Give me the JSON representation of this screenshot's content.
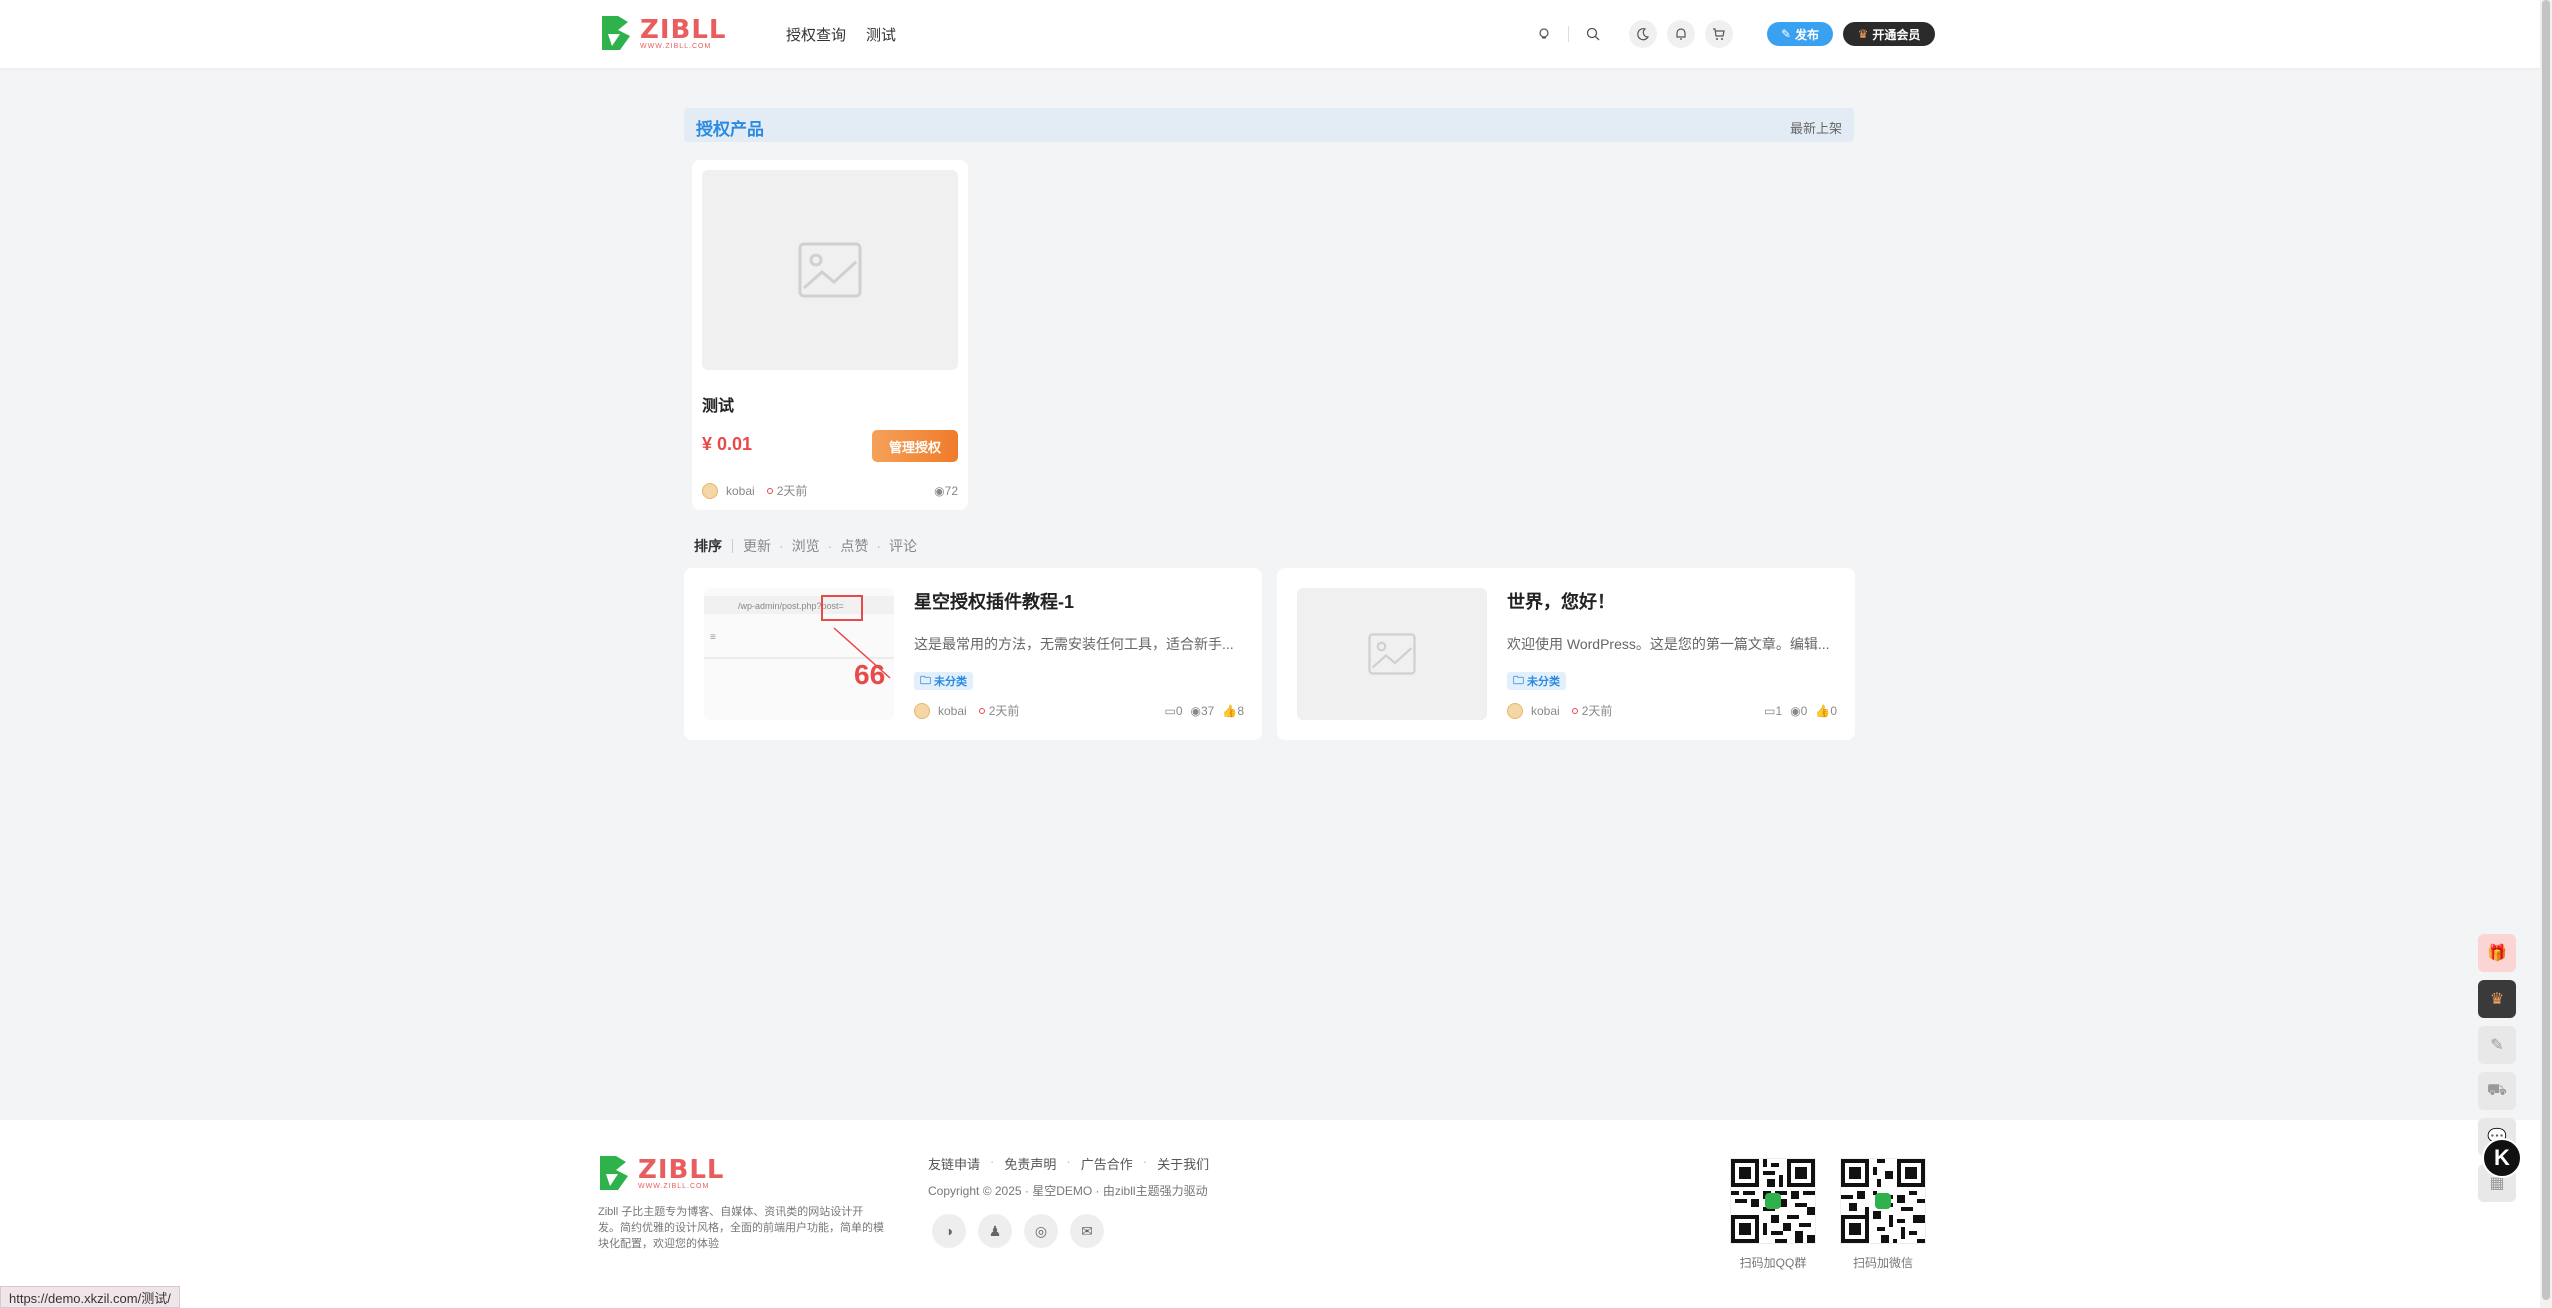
{
  "header": {
    "logo_word": "ZIBLL",
    "logo_sub": "WWW.ZIBLL.COM",
    "nav": [
      "授权查询",
      "测试"
    ],
    "publish_label": "发布",
    "vip_label": "开通会员"
  },
  "section": {
    "title": "授权产品",
    "more": "最新上架"
  },
  "product": {
    "title": "测试",
    "price": "¥ 0.01",
    "button": "管理授权",
    "author": "kobai",
    "time": "2天前",
    "views": "72"
  },
  "sort": {
    "label": "排序",
    "options": [
      "更新",
      "浏览",
      "点赞",
      "评论"
    ]
  },
  "posts": [
    {
      "title": "星空授权插件教程-1",
      "excerpt": "这是最常用的方法，无需安装任何工具，适合新手...",
      "tag": "未分类",
      "author": "kobai",
      "time": "2天前",
      "comments": "0",
      "views": "37",
      "likes": "8",
      "thumb_url_text": "/wp-admin/post.php?post=",
      "thumb_highlight": "post=",
      "thumb_number": "66"
    },
    {
      "title": "世界，您好！",
      "excerpt": "欢迎使用 WordPress。这是您的第一篇文章。编辑...",
      "tag": "未分类",
      "author": "kobai",
      "time": "2天前",
      "comments": "1",
      "views": "0",
      "likes": "0"
    }
  ],
  "footer": {
    "desc": "Zibll 子比主题专为博客、自媒体、资讯类的网站设计开发。简约优雅的设计风格，全面的前端用户功能，简单的模块化配置，欢迎您的体验",
    "links": [
      "友链申请",
      "免责声明",
      "广告合作",
      "关于我们"
    ],
    "copyright": "Copyright © 2025 · 星空DEMO · 由zibll主题强力驱动",
    "qr1_label": "扫码加QQ群",
    "qr2_label": "扫码加微信"
  },
  "status_url": "https://demo.xkzil.com/测试/",
  "colors": {
    "accent_blue": "#2b8be0",
    "price_red": "#e84a4a",
    "button_orange": "#f07b2a",
    "logo_green": "#2fb24c"
  }
}
